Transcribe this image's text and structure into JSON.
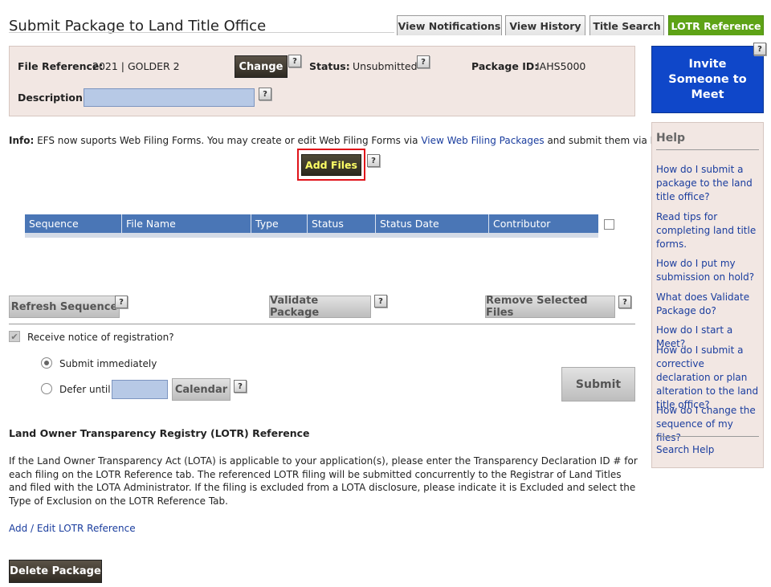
{
  "page": {
    "title": "Submit Package to Land Title Office"
  },
  "tabs": [
    {
      "label": "View Notifications"
    },
    {
      "label": "View History"
    },
    {
      "label": "Title Search"
    },
    {
      "label": "LOTR Reference",
      "active": true
    }
  ],
  "file_panel": {
    "file_ref_label": "File Reference:",
    "file_ref_value": "2021 | GOLDER 2",
    "change_button": "Change",
    "status_label": "Status:",
    "status_value": "Unsubmitted",
    "package_id_label": "Package ID:",
    "package_id_value": "IAHS5000",
    "description_label": "Description:",
    "description_value": ""
  },
  "help_glyph": "?",
  "invite_button": "Invite Someone to Meet",
  "info": {
    "label": "Info:",
    "text_before": " EFS now suports Web Filing Forms. You may create or edit Web Filing Forms via ",
    "link": "View Web Filing Packages",
    "text_after": " and submit them via EFS."
  },
  "add_files_button": "Add Files",
  "table": {
    "columns": [
      "Sequence",
      "File Name",
      "Type",
      "Status",
      "Status Date",
      "Contributor"
    ],
    "rows": []
  },
  "actions": {
    "refresh": "Refresh Sequence",
    "validate": "Validate Package",
    "remove": "Remove Selected Files"
  },
  "notice": {
    "checkbox_label": "Receive notice of registration?",
    "checked": true,
    "submit_immediately": "Submit immediately",
    "defer_until": "Defer until",
    "calendar_button": "Calendar",
    "submit_button": "Submit"
  },
  "lotr": {
    "heading": "Land Owner Transparency Registry (LOTR) Reference",
    "paragraph": "If the Land Owner Transparency Act (LOTA) is applicable to your application(s), please enter the Transparency Declaration ID # for each filing on the LOTR Reference tab. The referenced LOTR filing will be submitted concurrently to the Registrar of Land Titles and filed with the LOTA Administrator. If the filing is excluded from a LOTA disclosure, please indicate it is Excluded and select the Type of Exclusion on the LOTR Reference Tab.",
    "link": "Add / Edit LOTR Reference"
  },
  "delete_button": "Delete Package",
  "help": {
    "title": "Help",
    "links": [
      "How do I submit a package to the land title office?",
      "Read tips for completing land title forms.",
      "How do I put my submission on hold?",
      "What does Validate Package do?",
      "How do I start a Meet?",
      "How do I submit a corrective declaration or plan alteration to the land title office?",
      "How do I change the sequence of my files?"
    ],
    "search": "Search Help"
  },
  "colors": {
    "tab_active": "#5ea316",
    "invite_blue": "#0f47c9",
    "table_header": "#4a76b6",
    "panel_bg": "#f2e7e3",
    "link": "#1a3d9e",
    "highlight_border": "#e0141a",
    "add_files_text": "#ffff66"
  },
  "icons": [
    "help-question-icon",
    "checkbox-checked-icon",
    "radio-selected-icon",
    "radio-unselected-icon"
  ]
}
